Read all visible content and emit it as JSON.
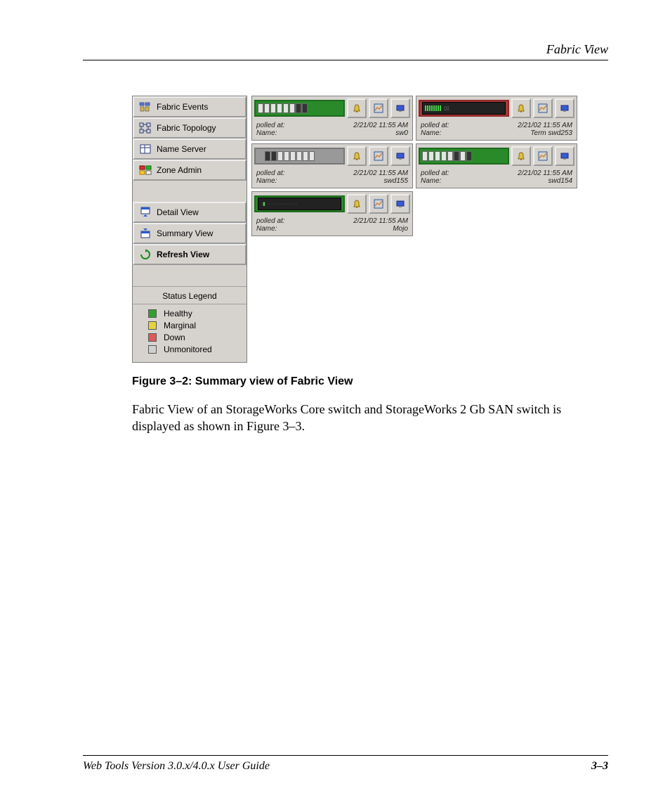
{
  "header": {
    "title": "Fabric View"
  },
  "sidebar": {
    "items": [
      {
        "label": "Fabric Events",
        "icon": "fabric-events-icon"
      },
      {
        "label": "Fabric Topology",
        "icon": "fabric-topology-icon"
      },
      {
        "label": "Name Server",
        "icon": "name-server-icon"
      },
      {
        "label": "Zone Admin",
        "icon": "zone-admin-icon"
      }
    ],
    "views": [
      {
        "label": "Detail View",
        "icon": "detail-view-icon"
      },
      {
        "label": "Summary View",
        "icon": "summary-view-icon"
      },
      {
        "label": "Refresh View",
        "icon": "refresh-icon",
        "bold": true
      }
    ],
    "legend_title": "Status Legend",
    "legend": [
      {
        "label": "Healthy",
        "color": "sw-green"
      },
      {
        "label": "Marginal",
        "color": "sw-yellow"
      },
      {
        "label": "Down",
        "color": "sw-red"
      },
      {
        "label": "Unmonitored",
        "color": "sw-grey"
      }
    ]
  },
  "switches": [
    {
      "name": "sw0",
      "polled_at": "2/21/02 11:55 AM",
      "status": "green",
      "label_polled": "polled at:",
      "label_name": "Name:"
    },
    {
      "name": "Term  swd253",
      "polled_at": "2/21/02 11:55 AM",
      "status": "red",
      "label_polled": "polled at:",
      "label_name": "Name:"
    },
    {
      "name": "swd155",
      "polled_at": "2/21/02 11:55 AM",
      "status": "grey",
      "label_polled": "polled at:",
      "label_name": "Name:"
    },
    {
      "name": "swd154",
      "polled_at": "2/21/02 11:55 AM",
      "status": "green",
      "label_polled": "polled at:",
      "label_name": "Name:"
    },
    {
      "name": "Mojo",
      "polled_at": "2/21/02 11:55 AM",
      "status": "green",
      "label_polled": "polled at:",
      "label_name": "Name:"
    }
  ],
  "caption": "Figure 3–2:  Summary view of Fabric View",
  "body": "Fabric View of an StorageWorks Core switch and StorageWorks 2 Gb SAN switch is displayed as shown in Figure 3–3.",
  "footer": {
    "left": "Web Tools Version 3.0.x/4.0.x User Guide",
    "right": "3–3"
  }
}
